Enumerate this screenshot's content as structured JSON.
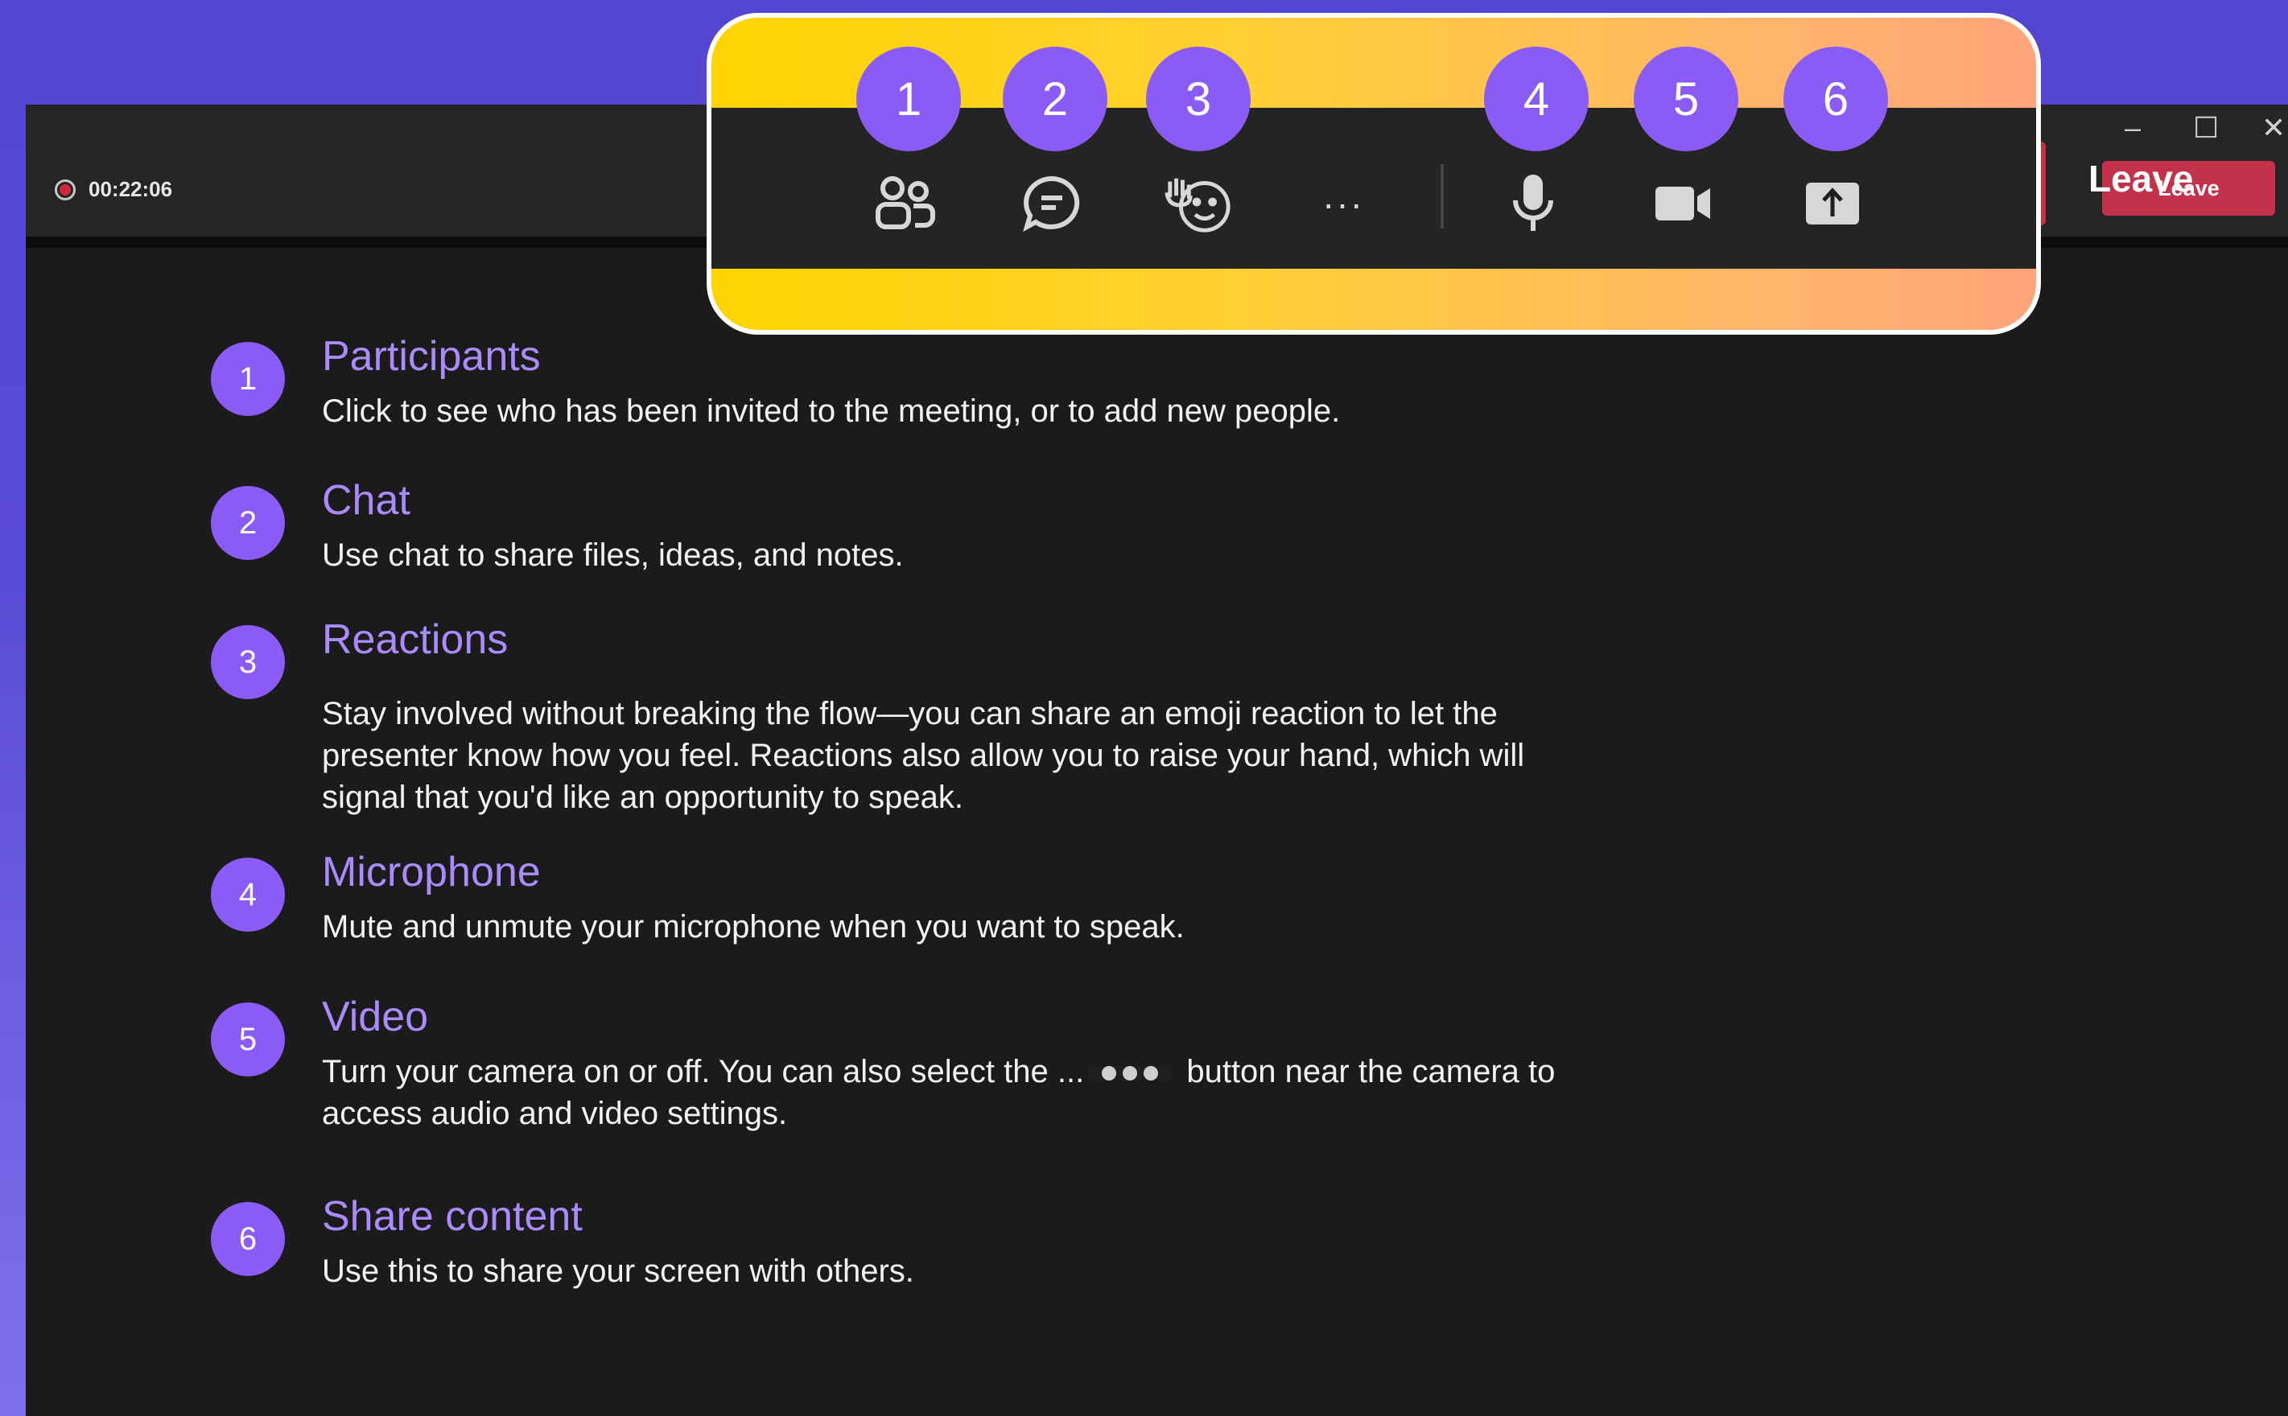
{
  "header": {
    "recording_time": "00:22:06",
    "leave_label": "Leave"
  },
  "toolbar": {
    "badges": [
      "1",
      "2",
      "3",
      "4",
      "5",
      "6"
    ],
    "more_label": "···"
  },
  "items": [
    {
      "number": "1",
      "title": "Participants",
      "description": "Click to see who has been invited to the meeting, or to add new people."
    },
    {
      "number": "2",
      "title": "Chat",
      "description": "Use chat to share files, ideas, and notes."
    },
    {
      "number": "3",
      "title": "Reactions",
      "description": "Stay involved without breaking the flow—you can share an emoji reaction to let the presenter know how you feel. Reactions also allow you to raise your hand, which will signal that you'd like an opportunity to speak."
    },
    {
      "number": "4",
      "title": "Microphone",
      "description": "Mute and unmute your microphone when you want to speak."
    },
    {
      "number": "5",
      "title": "Video",
      "description_before": "Turn your camera on or off. You can also select the ...",
      "description_after": " button near the camera to access audio and video settings."
    },
    {
      "number": "6",
      "title": "Share content",
      "description": "Use this to share your screen with others."
    }
  ],
  "colors": {
    "accent": "#8a5cf5",
    "title_text": "#a98bfb",
    "leave_red": "#c4314b",
    "callout_yellow": "#ffd400",
    "callout_peach": "#ffa47c"
  }
}
